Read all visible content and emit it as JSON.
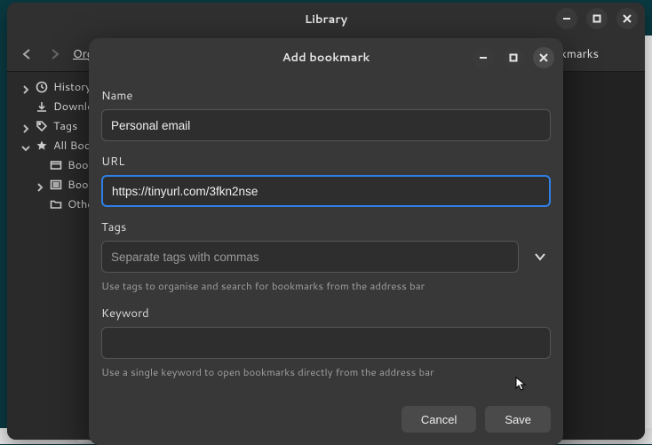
{
  "library": {
    "title": "Library",
    "toolbar": {
      "org_label": "Org",
      "right_label": "kmarks"
    },
    "sidebar": [
      {
        "label": "History",
        "icon": "clock-icon",
        "expander": "right",
        "depth": 0
      },
      {
        "label": "Downloa…",
        "icon": "download-icon",
        "expander": "none",
        "depth": 0
      },
      {
        "label": "Tags",
        "icon": "tag-icon",
        "expander": "right",
        "depth": 0
      },
      {
        "label": "All Bookm…",
        "icon": "star-icon",
        "expander": "down",
        "depth": 0
      },
      {
        "label": "Bookm…",
        "icon": "toolbar-icon",
        "expander": "none",
        "depth": 1
      },
      {
        "label": "Bookm…",
        "icon": "menu-icon",
        "expander": "right",
        "depth": 1
      },
      {
        "label": "Other B…",
        "icon": "folder-icon",
        "expander": "none",
        "depth": 1
      }
    ]
  },
  "modal": {
    "title": "Add bookmark",
    "name": {
      "label": "Name",
      "value": "Personal email"
    },
    "url": {
      "label": "URL",
      "value": "https://tinyurl.com/3fkn2nse"
    },
    "tags": {
      "label": "Tags",
      "value": "",
      "placeholder": "Separate tags with commas",
      "help": "Use tags to organise and search for bookmarks from the address bar"
    },
    "keyword": {
      "label": "Keyword",
      "value": "",
      "help": "Use a single keyword to open bookmarks directly from the address bar"
    },
    "buttons": {
      "cancel": "Cancel",
      "save": "Save"
    }
  }
}
